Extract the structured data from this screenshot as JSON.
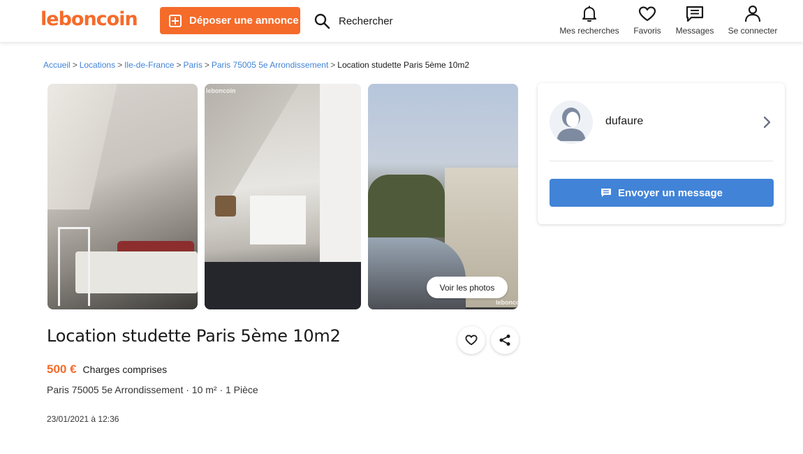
{
  "header": {
    "logo": "leboncoin",
    "post_label": "Déposer une annonce",
    "search_label": "Rechercher",
    "nav": {
      "searches": "Mes recherches",
      "favorites": "Favoris",
      "messages": "Messages",
      "login": "Se connecter"
    }
  },
  "breadcrumb": {
    "items": [
      "Accueil",
      "Locations",
      "Ile-de-France",
      "Paris",
      "Paris 75005 5e Arrondissement"
    ],
    "current": "Location studette Paris 5ème 10m2"
  },
  "gallery": {
    "watermark": "leboncoin",
    "see_photos": "Voir les photos"
  },
  "ad": {
    "title": "Location studette Paris 5ème 10m2",
    "price": "500 €",
    "charges": "Charges comprises",
    "location": "Paris 75005 5e Arrondissement · 10 m² · 1 Pièce",
    "date": "23/01/2021 à 12:36"
  },
  "seller": {
    "name": "dufaure",
    "message_label": "Envoyer un message"
  },
  "colors": {
    "brand": "#f56b2a",
    "link": "#4183d7",
    "button_blue": "#4183d7"
  }
}
